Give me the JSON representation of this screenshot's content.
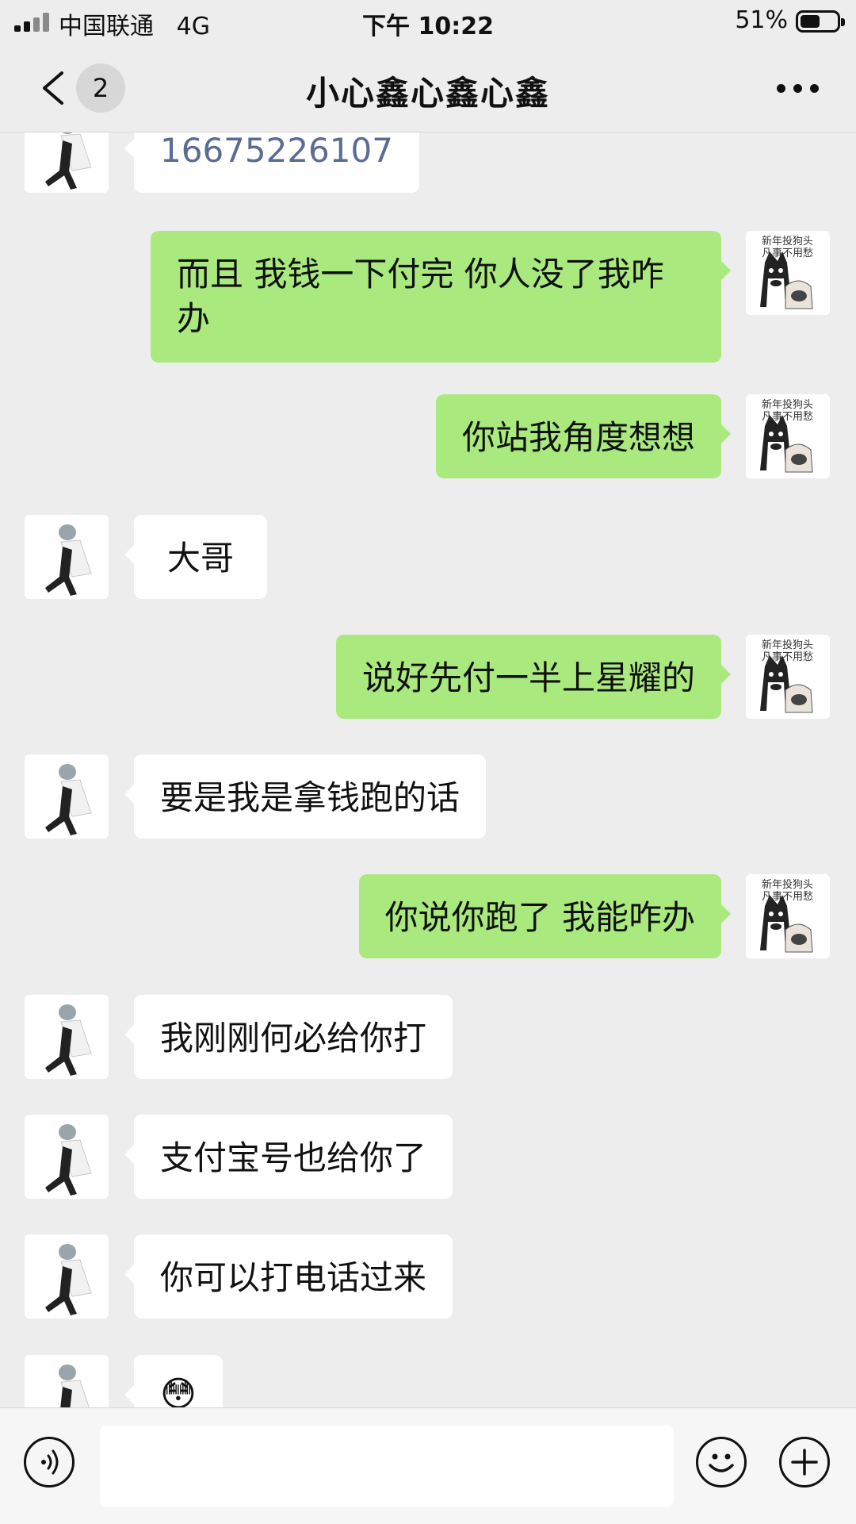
{
  "status_bar": {
    "carrier": "中国联通",
    "network": "4G",
    "time": "下午 10:22",
    "battery": "51%"
  },
  "nav": {
    "unread_count": "2",
    "title": "小心鑫心鑫心鑫"
  },
  "messages": [
    {
      "sender": "other",
      "text": "16675226107"
    },
    {
      "sender": "me",
      "text": "而且 我钱一下付完 你人没了我咋办"
    },
    {
      "sender": "me",
      "text": "你站我角度想想"
    },
    {
      "sender": "other",
      "text": "大哥"
    },
    {
      "sender": "me",
      "text": "说好先付一半上星耀的"
    },
    {
      "sender": "other",
      "text": "要是我是拿钱跑的话"
    },
    {
      "sender": "me",
      "text": "你说你跑了 我能咋办"
    },
    {
      "sender": "other",
      "text": "我刚刚何必给你打"
    },
    {
      "sender": "other",
      "text": "支付宝号也给你了"
    },
    {
      "sender": "other",
      "text": "你可以打电话过来"
    },
    {
      "sender": "other",
      "text": "😳"
    }
  ],
  "my_avatar_caption": [
    "新年投狗头",
    "凡事不用愁"
  ],
  "input": {
    "value": "",
    "placeholder": ""
  },
  "colors": {
    "background": "#ededed",
    "outgoing_bubble": "#a9e97e",
    "incoming_bubble": "#ffffff",
    "phone_link": "#5a6b94"
  },
  "icons": {
    "back": "chevron-left-icon",
    "more": "more-dots-icon",
    "voice": "voice-icon",
    "emoji": "emoji-icon",
    "add": "plus-icon"
  }
}
